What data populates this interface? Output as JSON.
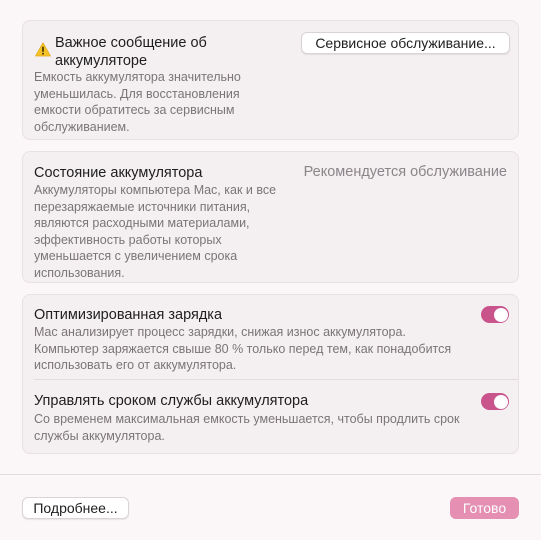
{
  "notice": {
    "title": "Важное сообщение об аккумуляторе",
    "description": "Емкость аккумулятора значительно уменьшилась. Для восстановления емкости обратитесь за сервисным обслуживанием.",
    "service_button": "Сервисное обслуживание..."
  },
  "health": {
    "title": "Состояние аккумулятора",
    "status": "Рекомендуется обслуживание",
    "description": "Аккумуляторы компьютера Mac, как и все перезаряжаемые источники питания, являются расходными материалами, эффективность работы которых уменьшается с увеличением срока использования."
  },
  "optimized": {
    "title": "Оптимизированная зарядка",
    "description": "Mac анализирует процесс зарядки, снижая износ аккумулятора. Компьютер заряжается свыше 80 % только перед тем, как понадобится использовать его от аккумулятора.",
    "enabled": true
  },
  "lifespan": {
    "title": "Управлять сроком службы аккумулятора",
    "description": "Со временем максимальная емкость уменьшается, чтобы продлить срок службы аккумулятора.",
    "enabled": true
  },
  "footer": {
    "more_button": "Подробнее...",
    "done_button": "Готово"
  },
  "colors": {
    "accent": "#c9548c",
    "warning": "#f5c228"
  }
}
